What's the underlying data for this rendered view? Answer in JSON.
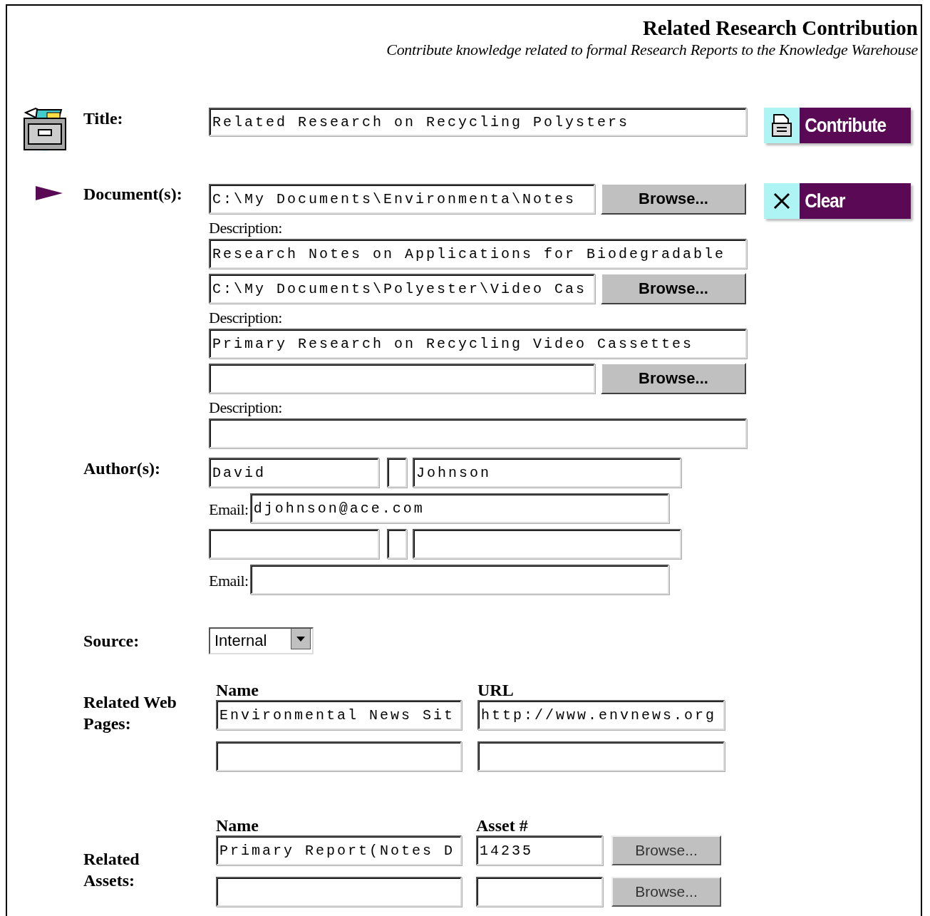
{
  "header": {
    "title": "Related Research Contribution",
    "subtitle": "Contribute knowledge related to formal Research Reports to the Knowledge Warehouse"
  },
  "title_field": {
    "label": "Title:",
    "value": "Related Research on Recycling Polysters"
  },
  "actions": [
    {
      "kind": "contribute",
      "label": "Contribute"
    },
    {
      "kind": "clear",
      "label": "Clear"
    }
  ],
  "documents": {
    "label": "Document(s):",
    "items": [
      {
        "path": "C:\\My Documents\\Environmenta\\Notes",
        "browse": "Browse...",
        "description_label": "Description:",
        "description": "Research Notes on Applications for Biodegradable"
      },
      {
        "path": "C:\\My Documents\\Polyester\\Video Cas",
        "browse": "Browse...",
        "description_label": "Description:",
        "description": "Primary Research on Recycling Video Cassettes"
      },
      {
        "browse": "Browse...",
        "description_label": "Description:"
      }
    ]
  },
  "authors": {
    "label": "Author(s):",
    "items": [
      {
        "first": "David",
        "last": "Johnson",
        "email_label": "Email:",
        "email": "djohnson@ace.com"
      },
      {
        "email_label": "Email:"
      }
    ]
  },
  "source": {
    "label": "Source:",
    "value": "Internal"
  },
  "web_pages": {
    "label": "Related Web Pages:",
    "columns": [
      "Name",
      "URL"
    ],
    "rows": [
      {
        "name": "Environmental News Sit",
        "url": "http://www.envnews.org"
      },
      {}
    ]
  },
  "assets": {
    "label": "Related Assets:",
    "columns": [
      "Name",
      "Asset #"
    ],
    "rows": [
      {
        "name": "Primary Report(Notes D",
        "asset": "14235",
        "browse": "Browse..."
      },
      {
        "browse": "Browse..."
      }
    ]
  }
}
